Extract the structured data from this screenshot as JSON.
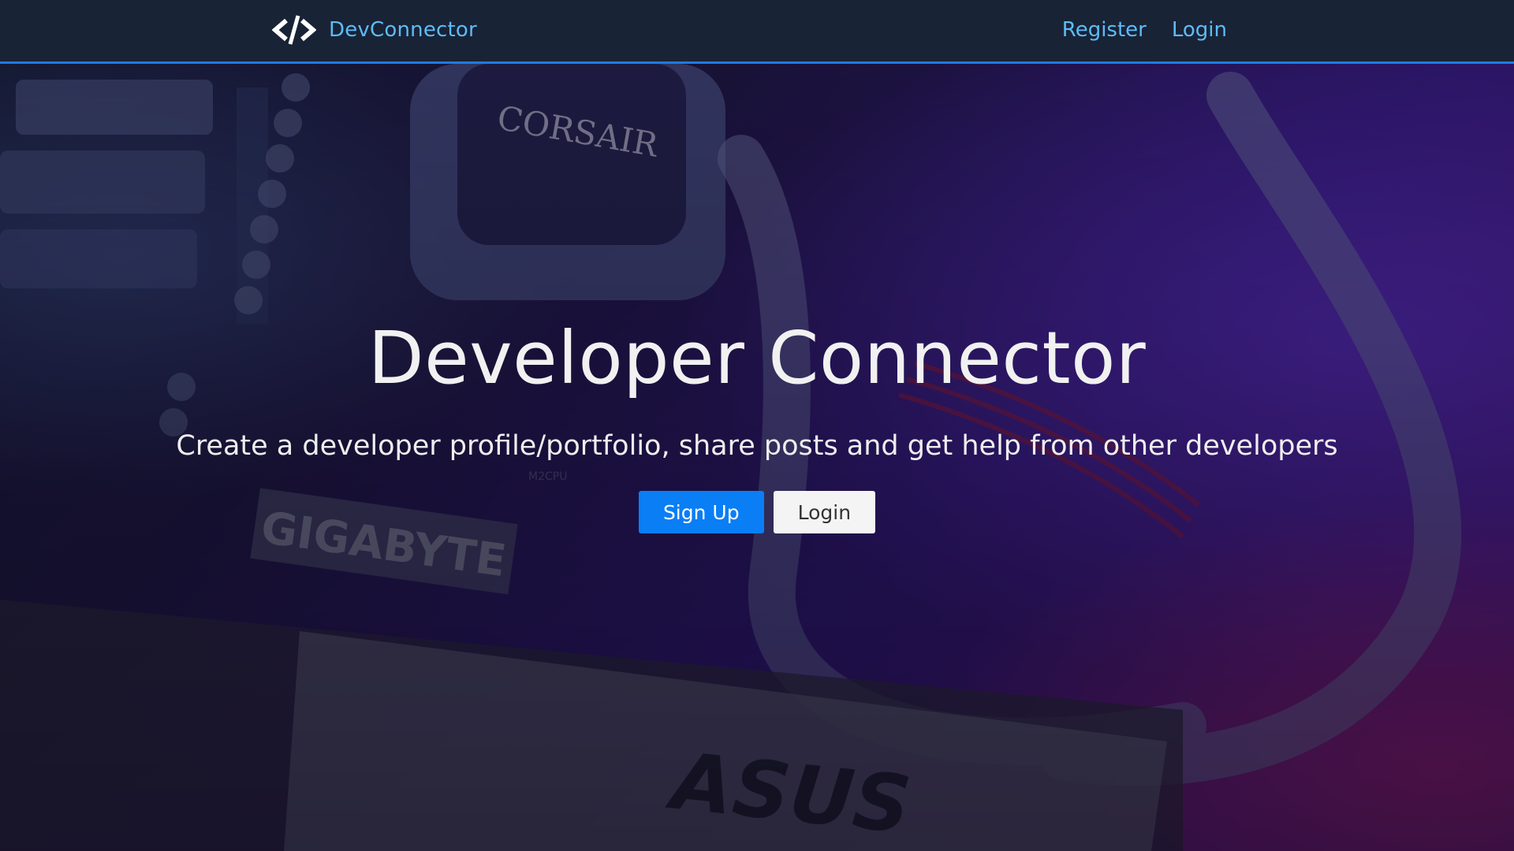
{
  "navbar": {
    "brand_icon": "code-icon",
    "brand_text": "DevConnector",
    "links": [
      {
        "label": "Register"
      },
      {
        "label": "Login"
      }
    ]
  },
  "hero": {
    "background": "photo-of-pc-internals-corsair-gigabyte-asus",
    "background_photo_lettering": [
      "CORSAIR",
      "GIGABYTE",
      "M2CPU",
      "ASUS"
    ],
    "title": "Developer Connector",
    "lead": "Create a developer profile/portfolio, share posts and get help from other developers",
    "buttons": {
      "primary": "Sign Up",
      "secondary": "Login"
    }
  },
  "colors": {
    "navbar_bg": "#182336",
    "navbar_border": "#1f7ae0",
    "link": "#5fbbf5",
    "primary": "#0a7ef5",
    "light": "#f4f4f4"
  }
}
